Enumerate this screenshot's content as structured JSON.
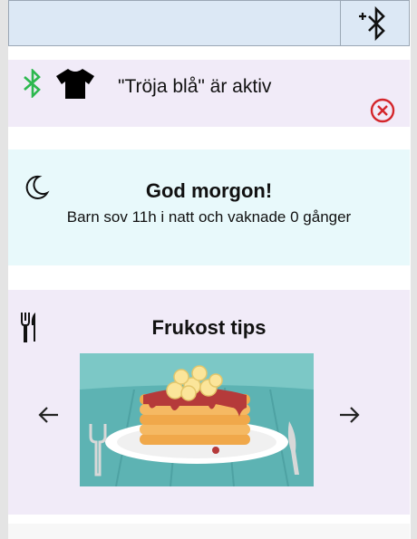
{
  "device": {
    "status_text": "\"Tröja blå\" är aktiv",
    "icons": [
      "bluetooth-icon",
      "shirt-icon",
      "close-circle-icon"
    ]
  },
  "sleep": {
    "title": "God morgon!",
    "summary": "Barn sov 11h i natt och vaknade 0 gånger",
    "icon": "moon-icon"
  },
  "breakfast": {
    "title": "Frukost tips",
    "icons": [
      "cutlery-icon",
      "arrow-left-icon",
      "arrow-right-icon"
    ],
    "image": "pancakes-with-bananas"
  },
  "topbar": {
    "icons": [
      "add-bluetooth-icon"
    ]
  },
  "colors": {
    "topbar_bg": "#dce8f5",
    "lavender_card": "#f1ebf8",
    "cyan_card": "#e8f9fb",
    "bluetooth_green": "#2db84f",
    "close_red": "#d4262b"
  }
}
